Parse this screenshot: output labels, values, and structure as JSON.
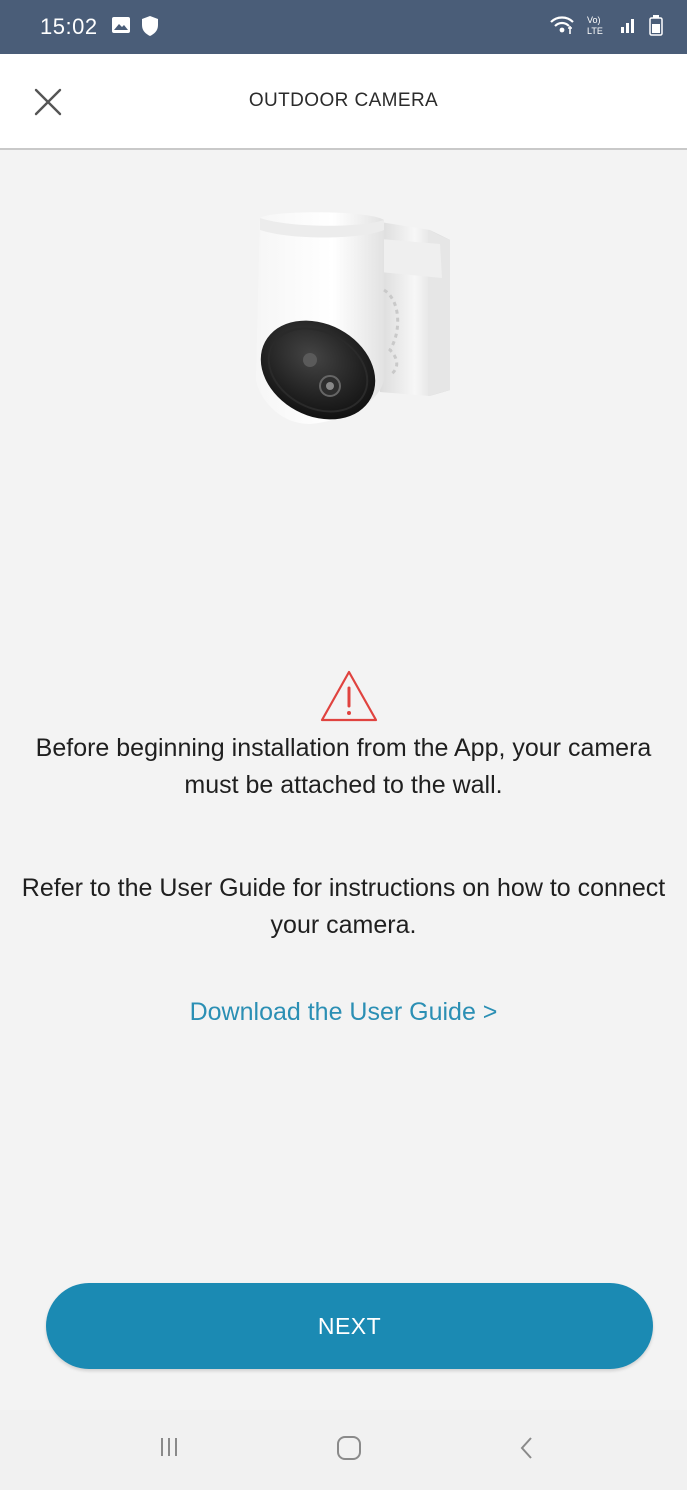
{
  "status_bar": {
    "time": "15:02",
    "left_icons": [
      "gallery-icon",
      "shield-icon"
    ],
    "right_icons": [
      "wifi-icon",
      "volte-icon",
      "signal-icon",
      "battery-icon"
    ],
    "volte_text": "Vo)\nLTE",
    "color": "#4a5d78"
  },
  "header": {
    "title": "OUTDOOR CAMERA",
    "close_icon": "close-icon"
  },
  "content": {
    "product_image": "outdoor-camera-image",
    "warning_icon": "warning-triangle-icon",
    "warning_color": "#e0433f",
    "message_1": "Before beginning installation from the App, your camera must be attached to the wall.",
    "message_2": "Refer to the User Guide for instructions on how to connect your camera.",
    "link_text": "Download the User Guide >",
    "link_color": "#2b8fb4"
  },
  "footer": {
    "next_label": "NEXT",
    "button_color": "#1b8ab3"
  },
  "nav_bar": {
    "items": [
      "recent-apps-icon",
      "home-icon",
      "back-icon"
    ]
  }
}
